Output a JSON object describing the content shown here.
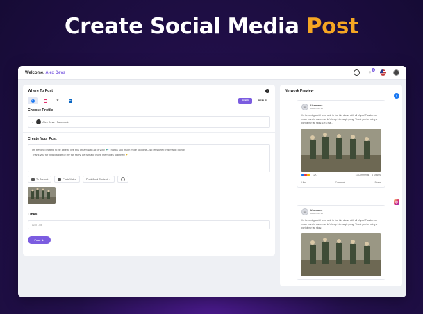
{
  "hero": {
    "title_main": "Create Social Media ",
    "title_accent": "Post"
  },
  "topbar": {
    "welcome_prefix": "Welcome, ",
    "user_name": "Alex Devs",
    "notification_count": "1"
  },
  "composer": {
    "where_to_post_label": "Where To Post",
    "platforms": [
      {
        "name": "facebook",
        "active": true
      },
      {
        "name": "instagram",
        "active": false
      },
      {
        "name": "x",
        "active": false
      },
      {
        "name": "linkedin",
        "active": false
      }
    ],
    "formats": [
      "FEED",
      "REELS"
    ],
    "active_format": "FEED",
    "choose_profile_label": "Choose Profile",
    "selected_profile": "Alex Devs · Facebook",
    "create_post_label": "Create Your Post",
    "post_text_line1": "I'm beyond grateful to be able to live this dream with all of you!",
    "post_text_line1_end": " Thanks soo much more to come—so let's keep this magic going!",
    "post_text_line2": "Thank you for being a part of my fan story. Let's make more memories together!",
    "tools": {
      "upload": "To Content",
      "library": "Photo/Video",
      "mode": "Predefined Content"
    },
    "links_label": "Links",
    "links_placeholder": "Add Link",
    "post_button": "Post"
  },
  "preview": {
    "title": "Network Preview",
    "cards": [
      {
        "network": "facebook",
        "name": "Username",
        "date": "December 25",
        "text": "I'm beyond grateful to be able to live this dream with all of you! Thanks soo much more to come—so let's keep this magic going! Thank you for being a part of my fan story. Let's ma...",
        "likes": "12K",
        "comments": "11 Comments",
        "shares": "4 Shares",
        "actions": [
          "Like",
          "Comment",
          "Share"
        ]
      },
      {
        "network": "instagram",
        "name": "Username",
        "date": "December 25",
        "text": "I'm beyond grateful to be able to live this dream with all of you! Thanks soo much more to come—so let's keep this magic going! Thank you for being a part of my fan story."
      }
    ]
  },
  "colors": {
    "accent": "#7b5ce0",
    "hero_accent": "#f5a623",
    "facebook": "#1877f2"
  }
}
